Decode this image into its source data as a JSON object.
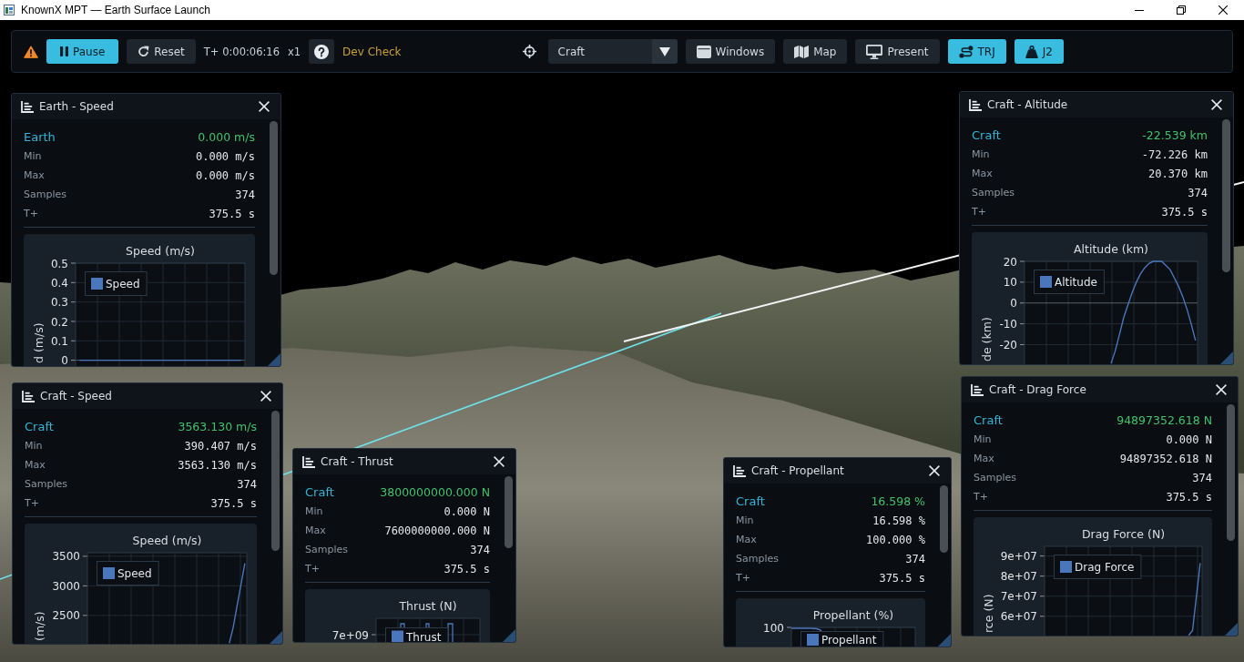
{
  "window": {
    "title": "KnownX MPT — Earth Surface Launch"
  },
  "toolbar": {
    "pause_button": {
      "label": "Pause"
    },
    "reset_button": {
      "label": "Reset"
    },
    "clock": "T+ 0:00:06:16",
    "speed": "x1",
    "dev_check": "Dev Check",
    "target_select": {
      "value": "Craft"
    },
    "view_buttons": [
      {
        "label": "Windows",
        "on": false
      },
      {
        "label": "Map",
        "on": false
      },
      {
        "label": "Present",
        "on": false
      },
      {
        "label": "TRJ",
        "on": true
      },
      {
        "label": "J2",
        "on": true
      }
    ]
  },
  "panels": [
    {
      "title": "Earth - Speed",
      "rows": [
        {
          "kind": "current",
          "label": "Earth",
          "value": "0.000 m/s"
        },
        {
          "kind": "stat",
          "label": "Min",
          "value": "0.000 m/s"
        },
        {
          "kind": "stat",
          "label": "Max",
          "value": "0.000 m/s"
        },
        {
          "kind": "stat",
          "label": "Samples",
          "value": "374"
        },
        {
          "kind": "stat",
          "label": "T+",
          "value": "375.5 s"
        }
      ],
      "chart_data": {
        "type": "line",
        "title": "Speed (m/s)",
        "ylabel": "d (m/s)",
        "ylim": [
          -0.03,
          0.5
        ],
        "yticks": [
          0,
          0.1,
          0.2,
          0.3,
          0.4,
          0.5
        ],
        "grid": true,
        "series": [
          {
            "name": "Speed",
            "color": "#4a76bb",
            "values": [
              0,
              0,
              0,
              0,
              0,
              0,
              0,
              0,
              0,
              0,
              0,
              0,
              0,
              0,
              0,
              0,
              0,
              0,
              0,
              0,
              0
            ]
          }
        ]
      }
    },
    {
      "title": "Craft - Altitude",
      "rows": [
        {
          "kind": "current",
          "label": "Craft",
          "value": "-22.539 km"
        },
        {
          "kind": "stat",
          "label": "Min",
          "value": "-72.226 km"
        },
        {
          "kind": "stat",
          "label": "Max",
          "value": "20.370 km"
        },
        {
          "kind": "stat",
          "label": "Samples",
          "value": "374"
        },
        {
          "kind": "stat",
          "label": "T+",
          "value": "375.5 s"
        }
      ],
      "chart_data": {
        "type": "line",
        "title": "Altitude (km)",
        "ylabel": "de (km)",
        "ylim": [
          -29.4,
          20
        ],
        "yticks": [
          -20,
          -10,
          0,
          10,
          20
        ],
        "grid": true,
        "series": [
          {
            "name": "Altitude",
            "color": "#4a76bb",
            "values": [
              null,
              null,
              null,
              null,
              null,
              null,
              null,
              null,
              null,
              null,
              null,
              null,
              null,
              null,
              null,
              null,
              null,
              null,
              null,
              null,
              -29,
              -23,
              -15,
              -7,
              -1,
              5,
              10,
              14,
              17,
              19,
              20,
              20,
              20,
              18,
              16,
              12,
              8,
              3,
              -3,
              -10,
              -18
            ]
          }
        ]
      }
    },
    {
      "title": "Craft - Speed",
      "rows": [
        {
          "kind": "current",
          "label": "Craft",
          "value": "3563.130 m/s"
        },
        {
          "kind": "stat",
          "label": "Min",
          "value": "390.407 m/s"
        },
        {
          "kind": "stat",
          "label": "Max",
          "value": "3563.130 m/s"
        },
        {
          "kind": "stat",
          "label": "Samples",
          "value": "374"
        },
        {
          "kind": "stat",
          "label": "T+",
          "value": "375.5 s"
        }
      ],
      "chart_data": {
        "type": "line",
        "title": "Speed (m/s)",
        "ylabel": "(m/s)",
        "ylim": [
          2020,
          3560
        ],
        "yticks": [
          2500,
          3000,
          3500
        ],
        "grid": true,
        "series": [
          {
            "name": "Speed",
            "color": "#4a76bb",
            "values": [
              null,
              null,
              null,
              null,
              null,
              null,
              null,
              null,
              null,
              null,
              null,
              null,
              null,
              null,
              null,
              null,
              null,
              null,
              null,
              null,
              null,
              null,
              null,
              null,
              null,
              null,
              null,
              null,
              null,
              null,
              null,
              null,
              null,
              null,
              null,
              null,
              2030,
              2300,
              2660,
              3020,
              3380
            ]
          }
        ]
      }
    },
    {
      "title": "Craft - Thrust",
      "rows": [
        {
          "kind": "current",
          "label": "Craft",
          "value": "3800000000.000 N"
        },
        {
          "kind": "stat",
          "label": "Min",
          "value": "0.000 N"
        },
        {
          "kind": "stat",
          "label": "Max",
          "value": "7600000000.000 N"
        },
        {
          "kind": "stat",
          "label": "Samples",
          "value": "374"
        },
        {
          "kind": "stat",
          "label": "T+",
          "value": "375.5 s"
        }
      ],
      "chart": {
        "title": "Thrust (N)",
        "ytick_labels": [
          "7e+09"
        ],
        "legend": "Thrust"
      }
    },
    {
      "title": "Craft - Propellant",
      "rows": [
        {
          "kind": "current",
          "label": "Craft",
          "value": "16.598 %"
        },
        {
          "kind": "stat",
          "label": "Min",
          "value": "16.598 %"
        },
        {
          "kind": "stat",
          "label": "Max",
          "value": "100.000 %"
        },
        {
          "kind": "stat",
          "label": "Samples",
          "value": "374"
        },
        {
          "kind": "stat",
          "label": "T+",
          "value": "375.5 s"
        }
      ],
      "chart": {
        "title": "Propellant (%)",
        "ytick_labels": [
          "100"
        ],
        "legend": "Propellant"
      }
    },
    {
      "title": "Craft - Drag Force",
      "rows": [
        {
          "kind": "current",
          "label": "Craft",
          "value": "94897352.618 N"
        },
        {
          "kind": "stat",
          "label": "Min",
          "value": "0.000 N"
        },
        {
          "kind": "stat",
          "label": "Max",
          "value": "94897352.618 N"
        },
        {
          "kind": "stat",
          "label": "Samples",
          "value": "374"
        },
        {
          "kind": "stat",
          "label": "T+",
          "value": "375.5 s"
        }
      ],
      "chart_data": {
        "type": "line",
        "title": "Drag Force (N)",
        "ylabel": "rce (N)",
        "ylim": [
          50400000,
          94800000
        ],
        "yticks": [
          {
            "value": 60000000,
            "label": "6e+07"
          },
          {
            "value": 70000000,
            "label": "7e+07"
          },
          {
            "value": 80000000,
            "label": "8e+07"
          },
          {
            "value": 90000000,
            "label": "9e+07"
          }
        ],
        "grid": true,
        "series": [
          {
            "name": "Drag Force",
            "color": "#4a76bb",
            "values": [
              null,
              null,
              null,
              null,
              null,
              null,
              null,
              null,
              null,
              null,
              null,
              null,
              null,
              null,
              null,
              null,
              null,
              null,
              null,
              null,
              null,
              null,
              null,
              null,
              null,
              null,
              null,
              null,
              null,
              null,
              null,
              null,
              null,
              null,
              null,
              null,
              null,
              50500000,
              52900000,
              69700000,
              86500000
            ]
          }
        ]
      }
    }
  ]
}
